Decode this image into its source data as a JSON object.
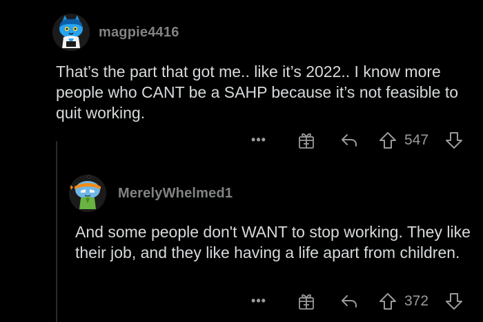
{
  "comments": [
    {
      "username": "magpie4416",
      "avatar": "snoo-avatar-blue-cat",
      "body": "That’s the part that got me.. like it’s 2022.. I know more people who CANT be a SAHP because it’s not feasible to quit working.",
      "actions": {
        "more": "•••",
        "award_icon": "gift-icon",
        "reply_icon": "reply-arrow-icon",
        "upvote_icon": "upvote-arrow-icon",
        "vote_count": "547",
        "downvote_icon": "downvote-arrow-icon"
      }
    },
    {
      "username": "MerelyWhelmed1",
      "avatar": "snoo-avatar-bandana",
      "body": "And some people don't WANT to stop working. They like their job, and they like having a life apart from children.",
      "actions": {
        "more": "•••",
        "award_icon": "gift-icon",
        "reply_icon": "reply-arrow-icon",
        "upvote_icon": "upvote-arrow-icon",
        "vote_count": "372",
        "downvote_icon": "downvote-arrow-icon"
      }
    }
  ],
  "colors": {
    "background": "#000000",
    "text": "#d7dadc",
    "muted": "#818384",
    "icon": "#9a9b9c",
    "thread_line": "#2a2a2b"
  }
}
